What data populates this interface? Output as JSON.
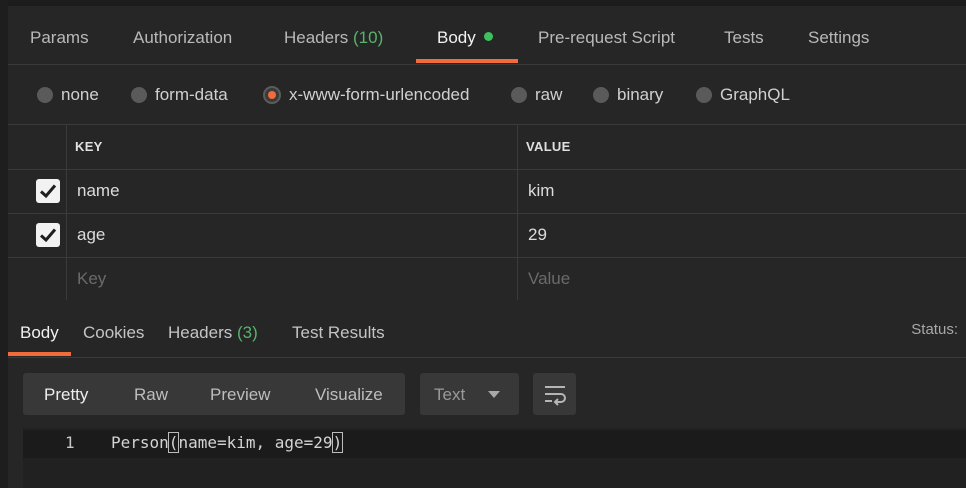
{
  "request_tabs": [
    {
      "label": "Params"
    },
    {
      "label": "Authorization"
    },
    {
      "label": "Headers",
      "count": "(10)"
    },
    {
      "label": "Body",
      "active": true
    },
    {
      "label": "Pre-request Script"
    },
    {
      "label": "Tests"
    },
    {
      "label": "Settings"
    }
  ],
  "body_types": [
    {
      "label": "none"
    },
    {
      "label": "form-data"
    },
    {
      "label": "x-www-form-urlencoded",
      "selected": true
    },
    {
      "label": "raw"
    },
    {
      "label": "binary"
    },
    {
      "label": "GraphQL"
    }
  ],
  "kv_table": {
    "key_header": "KEY",
    "value_header": "VALUE",
    "rows": [
      {
        "key": "name",
        "value": "kim",
        "checked": true
      },
      {
        "key": "age",
        "value": "29",
        "checked": true
      }
    ],
    "key_placeholder": "Key",
    "value_placeholder": "Value"
  },
  "response_tabs": [
    {
      "label": "Body",
      "active": true
    },
    {
      "label": "Cookies"
    },
    {
      "label": "Headers",
      "count": "(3)"
    },
    {
      "label": "Test Results"
    }
  ],
  "status_label": "Status:",
  "view_modes": [
    {
      "label": "Pretty",
      "active": true
    },
    {
      "label": "Raw"
    },
    {
      "label": "Preview"
    },
    {
      "label": "Visualize"
    }
  ],
  "format": {
    "selected": "Text"
  },
  "code": {
    "line_number": "1",
    "prefix": "Person",
    "open_paren": "(",
    "content": "name=kim, age=29",
    "close_paren": ")"
  },
  "colors": {
    "accent": "#f26b3a",
    "count": "#58b36a",
    "dot": "#3fbf5f"
  }
}
